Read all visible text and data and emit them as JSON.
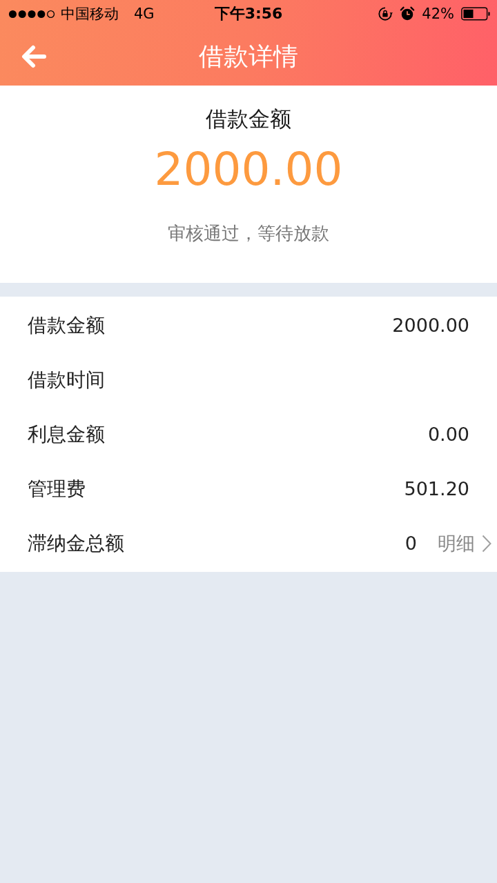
{
  "status_bar": {
    "carrier": "中国移动",
    "network": "4G",
    "time": "下午3:56",
    "battery_percent": "42%"
  },
  "nav_bar": {
    "title": "借款详情"
  },
  "summary": {
    "label": "借款金额",
    "amount": "2000.00",
    "status": "审核通过，等待放款"
  },
  "details": [
    {
      "kind": "plain",
      "label": "借款金额",
      "value": "2000.00"
    },
    {
      "kind": "plain",
      "label": "借款时间"
    },
    {
      "kind": "plain",
      "label": "利息金额",
      "value": "0.00"
    },
    {
      "kind": "plain",
      "label": "管理费",
      "value": "501.20"
    },
    {
      "kind": "link",
      "label": "滞纳金总额",
      "value": "0",
      "link": "明细"
    }
  ]
}
